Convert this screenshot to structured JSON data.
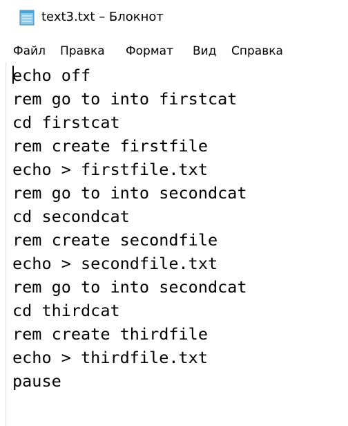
{
  "window": {
    "title": "text3.txt – Блокнот",
    "icon": "notepad-icon"
  },
  "menu": {
    "items": [
      "Файл",
      "Правка",
      "Формат",
      "Вид",
      "Справка"
    ]
  },
  "editor": {
    "lines": [
      "echo off",
      "rem go to into firstcat",
      "cd firstcat",
      "rem create firstfile",
      "echo > firstfile.txt",
      "rem go to into secondcat",
      "cd secondcat",
      "rem create secondfile",
      "echo > secondfile.txt",
      "rem go to into secondcat",
      "cd thirdcat",
      "rem create thirdfile",
      "echo > thirdfile.txt",
      "pause"
    ]
  }
}
